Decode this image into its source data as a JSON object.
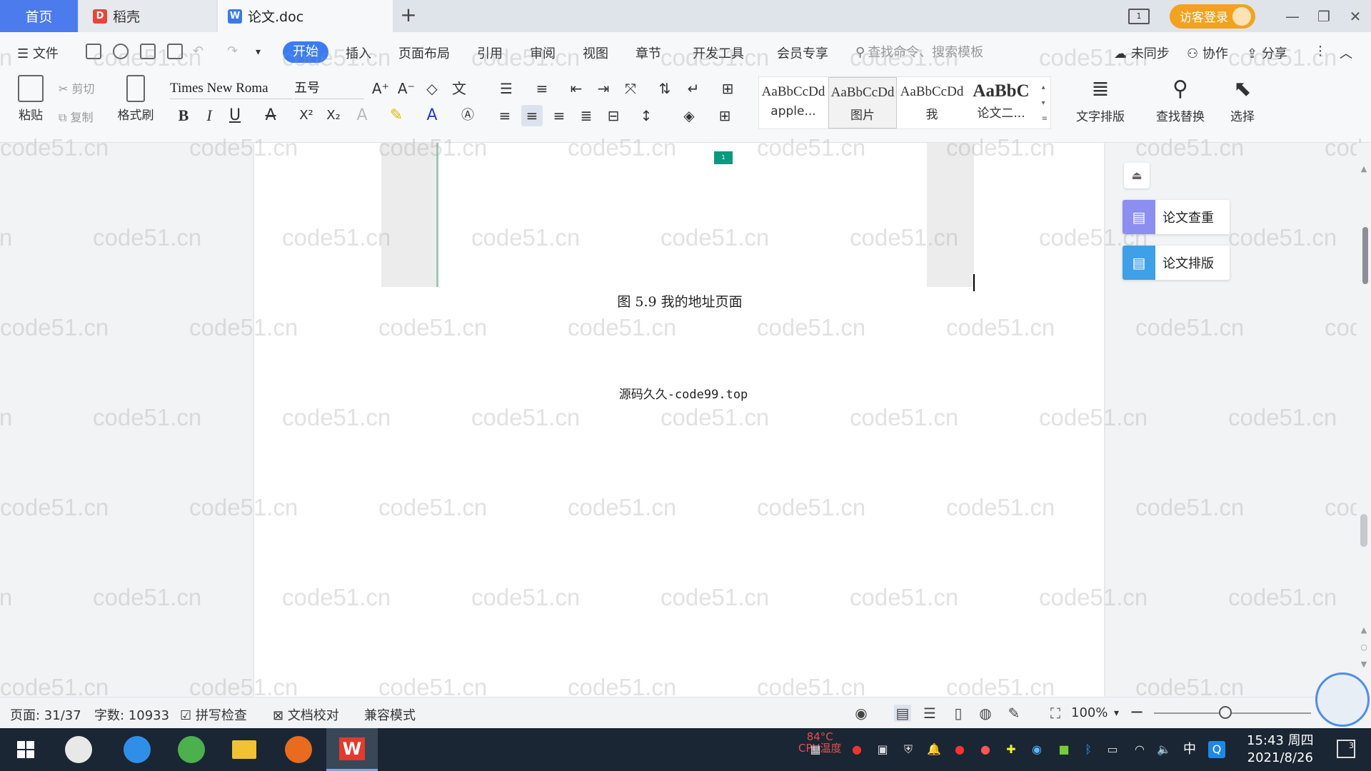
{
  "tabs": {
    "home": "首页",
    "daoke": "稻壳",
    "doc": "论文.doc",
    "add": "+"
  },
  "titlebar": {
    "login": "访客登录",
    "min": "—",
    "restore": "❐",
    "close": "✕"
  },
  "menu": {
    "file": "文件",
    "start": "开始",
    "insert": "插入",
    "layout": "页面布局",
    "reference": "引用",
    "review": "审阅",
    "view": "视图",
    "chapter": "章节",
    "devtools": "开发工具",
    "member": "会员专享",
    "search_placeholder": "查找命令、搜索模板",
    "unsynced": "未同步",
    "collab": "协作",
    "share": "分享"
  },
  "ribbon": {
    "paste": "粘贴",
    "cut": "剪切",
    "copy": "复制",
    "format_painter": "格式刷",
    "font_name": "Times New Roma",
    "font_size": "五号",
    "styles": [
      {
        "sample": "AaBbCcDd",
        "name": "apple..."
      },
      {
        "sample": "AaBbCcDd",
        "name": "图片"
      },
      {
        "sample": "AaBbCcDd",
        "name": "我"
      },
      {
        "sample": "AaBbC",
        "name": "论文二..."
      }
    ],
    "text_layout": "文字排版",
    "find_replace": "查找替换",
    "select": "选择"
  },
  "document": {
    "figure_badge": "1",
    "caption": "图 5.9  我的地址页面",
    "body_text": "源码久久-code99.top",
    "watermark": "code51.cn"
  },
  "side_panel": {
    "check": "论文查重",
    "format": "论文排版"
  },
  "status": {
    "page": "页面: 31/37",
    "words": "字数: 10933",
    "spell": "拼写检查",
    "proof": "文档校对",
    "compat": "兼容模式",
    "zoom": "100%"
  },
  "taskbar": {
    "cpu_temp": "84°C",
    "cpu_label": "CPU温度",
    "ime": "中",
    "time": "15:43 周四",
    "date": "2021/8/26",
    "notify_count": "3"
  },
  "colors": {
    "accent": "#3a7cf3",
    "home_tab": "#4b7bec",
    "login": "#f3a21f",
    "figure_badge": "#0c9a7c"
  }
}
